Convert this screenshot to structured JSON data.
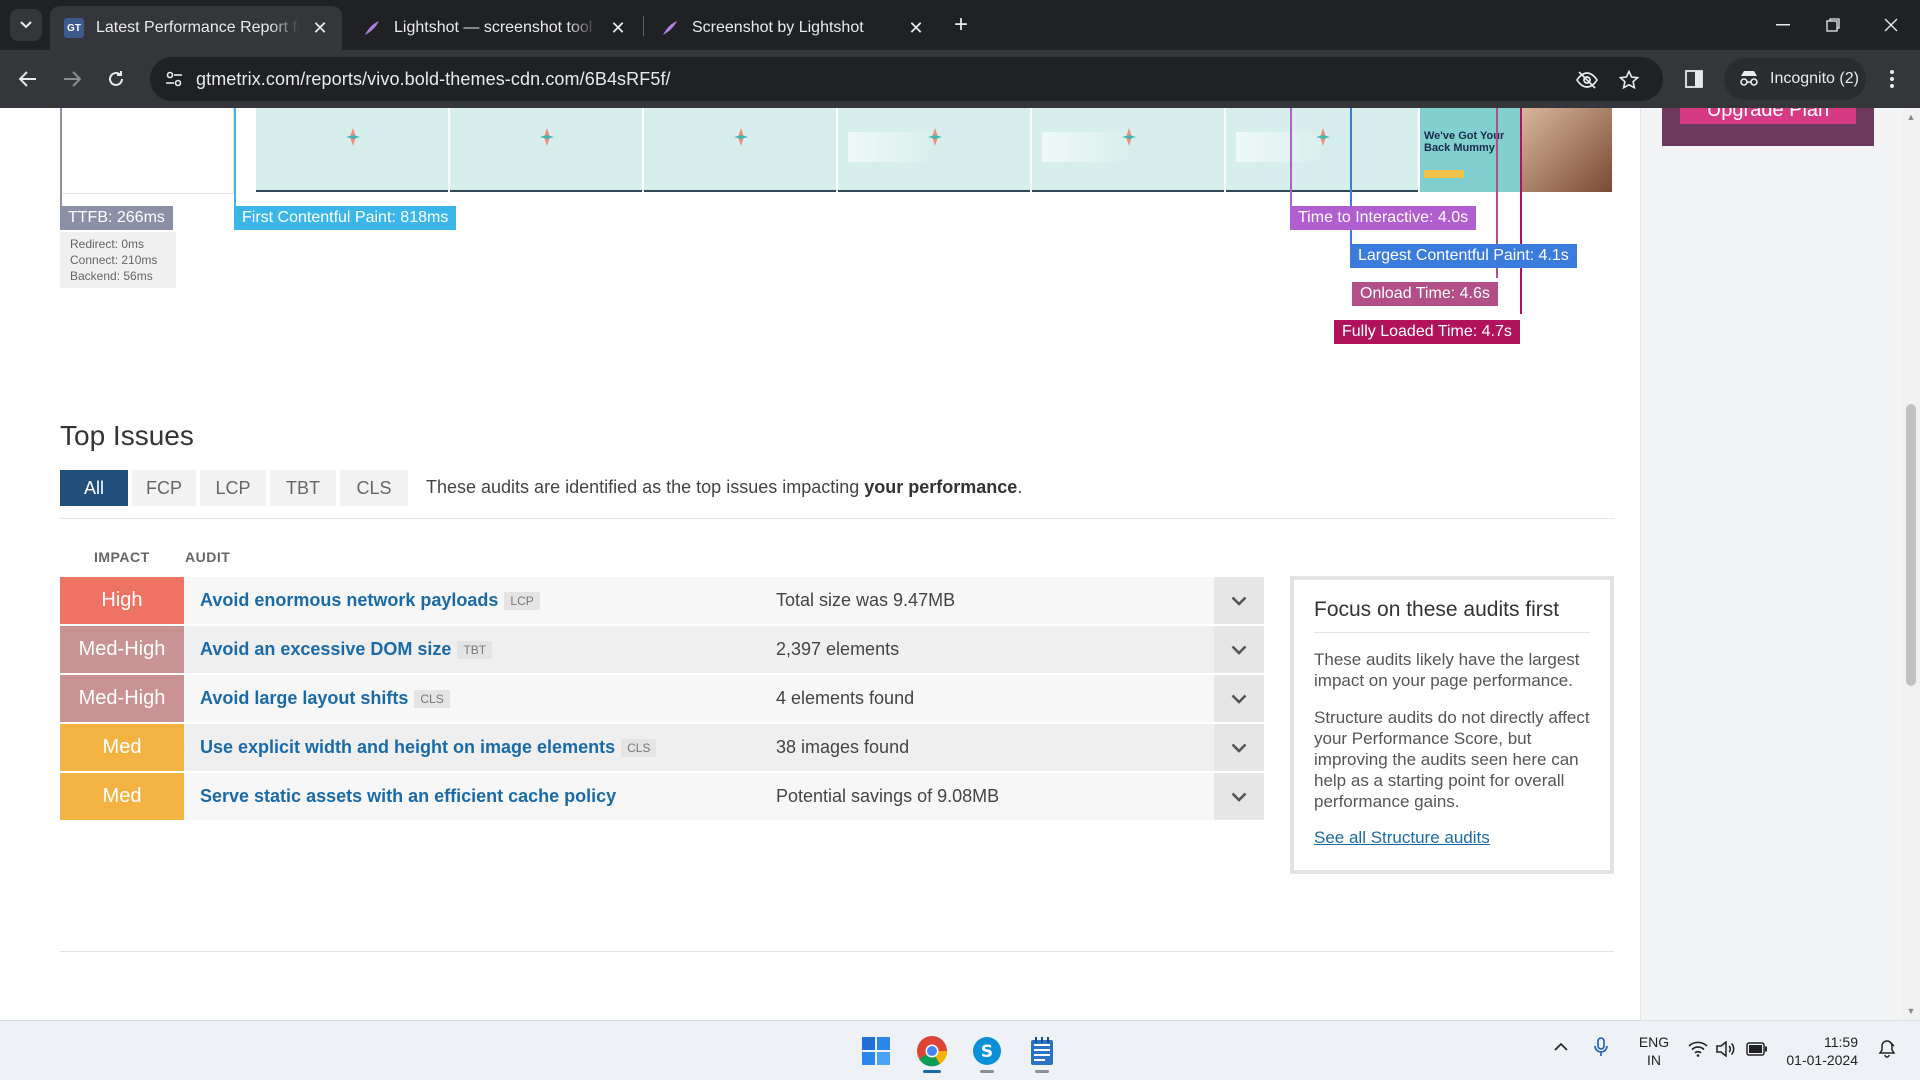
{
  "browser": {
    "tabs": [
      {
        "title": "Latest Performance Report for: h",
        "favicon": "GT",
        "active": true
      },
      {
        "title": "Lightshot — screenshot tool for",
        "active": false
      },
      {
        "title": "Screenshot by Lightshot",
        "active": false
      }
    ],
    "url": "gtmetrix.com/reports/vivo.bold-themes-cdn.com/6B4sRF5f/",
    "incognito_label": "Incognito (2)",
    "favicon_text": "GT"
  },
  "page": {
    "upgrade_label": "Upgrade Plan",
    "metrics": {
      "ttfb": "TTFB: 266ms",
      "ttfb_details": [
        "Redirect: 0ms",
        "Connect: 210ms",
        "Backend: 56ms"
      ],
      "fcp": "First Contentful Paint: 818ms",
      "tti": "Time to Interactive: 4.0s",
      "lcp": "Largest Contentful Paint: 4.1s",
      "onload": "Onload Time: 4.6s",
      "fully_loaded": "Fully Loaded Time: 4.7s"
    },
    "filmstrip_last_heading": "We've Got Your Back Mummy!",
    "top_issues": {
      "title": "Top Issues",
      "filters": [
        "All",
        "FCP",
        "LCP",
        "TBT",
        "CLS"
      ],
      "active_filter": "All",
      "description": "These audits are identified as the top issues impacting",
      "description_bold": "your performance",
      "description_end": ".",
      "columns": {
        "impact": "IMPACT",
        "audit": "AUDIT"
      },
      "rows": [
        {
          "impact": "High",
          "audit": "Avoid enormous network payloads",
          "tag": "LCP",
          "result": "Total size was 9.47MB"
        },
        {
          "impact": "Med-High",
          "audit": "Avoid an excessive DOM size",
          "tag": "TBT",
          "result": "2,397 elements"
        },
        {
          "impact": "Med-High",
          "audit": "Avoid large layout shifts",
          "tag": "CLS",
          "result": "4 elements found"
        },
        {
          "impact": "Med",
          "audit": "Use explicit width and height on image elements",
          "tag": "CLS",
          "result": "38 images found"
        },
        {
          "impact": "Med",
          "audit": "Serve static assets with an efficient cache policy",
          "tag": "",
          "result": "Potential savings of 9.08MB"
        }
      ],
      "impact_colors": {
        "High": "#ef7363",
        "Med-High": "#c99394",
        "Med": "#f3b343"
      }
    },
    "focus": {
      "title": "Focus on these audits first",
      "p1": "These audits likely have the largest impact on your page performance.",
      "p2": "Structure audits do not directly affect your Performance Score, but improving the audits seen here can help as a starting point for overall performance gains.",
      "link": "See all Structure audits"
    }
  },
  "taskbar": {
    "lang_top": "ENG",
    "lang_bottom": "IN",
    "time": "11:59",
    "date": "01-01-2024"
  },
  "colors": {
    "ttfb": "#8b8fa8",
    "fcp": "#3ab7e8",
    "tti": "#b05ed0",
    "lcp": "#3b7bdc",
    "onload": "#b14f86",
    "fully_loaded": "#b0135b"
  }
}
